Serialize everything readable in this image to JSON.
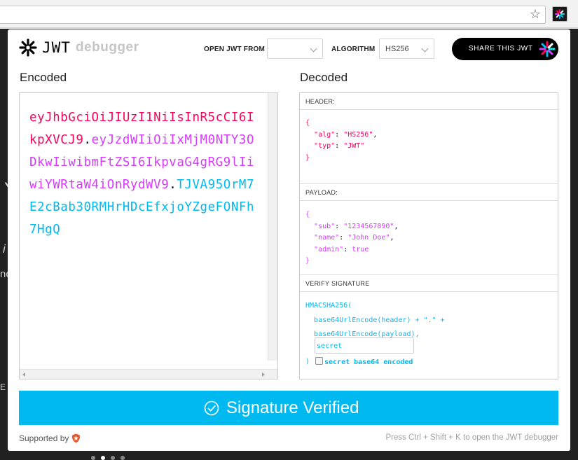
{
  "browser": {
    "url": "",
    "star_icon": "star-icon",
    "extension_icon": "jwt-extension-icon"
  },
  "background_page": {
    "fragment_1": "Y",
    "fragment_2": "i",
    "fragment_3": "nc",
    "fragment_4": "E",
    "carousel_dots": 4,
    "carousel_active": 1
  },
  "popup": {
    "logo": {
      "jwt": "JWT",
      "debugger": "debugger"
    },
    "open_jwt_from_label": "OPEN JWT FROM",
    "open_jwt_from_value": "",
    "algorithm_label": "ALGORITHM",
    "algorithm_value": "HS256",
    "share_button": "SHARE THIS JWT",
    "encoded_title": "Encoded",
    "decoded_title": "Decoded",
    "encoded_token": {
      "header": "eyJhbGciOiJIUzI1NiIsInR5cCI6IkpXVCJ9",
      "dot1": ".",
      "payload": "eyJzdWIiOiIxMjM0NTY3ODkwIiwibmFtZSI6IkpvaG4gRG9lIiwiYWRtaW4iOnRydWV9",
      "dot2": ".",
      "signature": "TJVA95OrM7E2cBab30RMHrHDcEfxjoYZgeFONFh7HgQ"
    },
    "header_section": {
      "title": "HEADER:",
      "open": "{",
      "alg_key": "\"alg\"",
      "alg_value": "\"HS256\"",
      "typ_key": "\"typ\"",
      "typ_value": "\"JWT\"",
      "close": "}"
    },
    "payload_section": {
      "title": "PAYLOAD:",
      "open": "{",
      "sub_key": "\"sub\"",
      "sub_value": "\"1234567890\"",
      "name_key": "\"name\"",
      "name_value": "\"John Doe\"",
      "admin_key": "\"admin\"",
      "admin_value": "true",
      "close": "}"
    },
    "signature_section": {
      "title": "VERIFY SIGNATURE",
      "line1": "HMACSHA256(",
      "line2": "base64UrlEncode(header) + \".\" +",
      "line3": "base64UrlEncode(payload),",
      "secret_value": "secret",
      "close": ")",
      "base64_label": "secret base64 encoded",
      "base64_checked": false
    },
    "verified_text": "Signature Verified",
    "supported_by": "Supported by",
    "shortcut_hint": "Press Ctrl + Shift + K to open the JWT debugger"
  },
  "colors": {
    "header": "#fb015b",
    "payload": "#d63aff",
    "signature": "#00b9f1",
    "verified_bg": "#00b9f1"
  }
}
